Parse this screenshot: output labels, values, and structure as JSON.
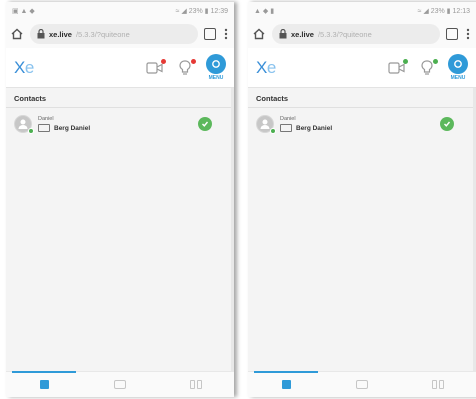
{
  "screens": [
    {
      "status": {
        "left": "▣ ▲ ◆",
        "right": "≈ ◢ 23% ▮ 12:39"
      },
      "browser": {
        "url_host": "xe.live",
        "url_path": "/5.3.3/?quiteone"
      },
      "header": {
        "logo_main": "X",
        "logo_accent": "e",
        "menu_label": "MENU",
        "dot1_color": "#e53935",
        "dot2_color": "#e53935"
      },
      "section_title": "Contacts",
      "contact": {
        "name_small": "Daniel",
        "name": "Berg Daniel",
        "status_color": "#5cb85c"
      }
    },
    {
      "status": {
        "left": "▲ ◆ ▮",
        "right": "≈ ◢ 23% ▮ 12:13"
      },
      "browser": {
        "url_host": "xe.live",
        "url_path": "/5.3.3/?quiteone"
      },
      "header": {
        "logo_main": "X",
        "logo_accent": "e",
        "menu_label": "MENU",
        "dot1_color": "#4caf50",
        "dot2_color": "#4caf50"
      },
      "section_title": "Contacts",
      "contact": {
        "name_small": "Daniel",
        "name": "Berg Daniel",
        "status_color": "#5cb85c"
      }
    }
  ],
  "colors": {
    "accent": "#2f9ad8",
    "logo": "#3a8fd8"
  }
}
